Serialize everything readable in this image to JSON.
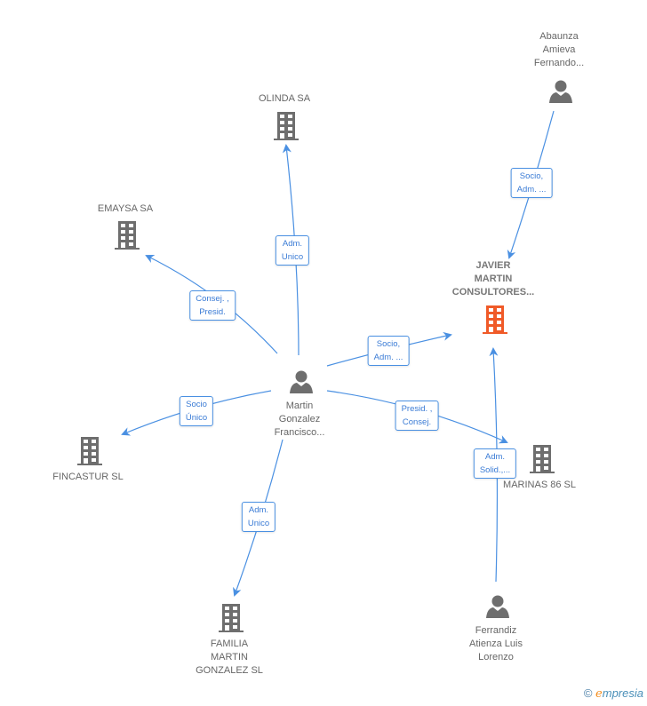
{
  "colors": {
    "edge": "#4a90e2",
    "company": "#6e6e6e",
    "focus_company": "#f05a28",
    "person": "#6e6e6e"
  },
  "nodes": {
    "olinda": {
      "label": "OLINDA SA",
      "type": "company"
    },
    "emaysa": {
      "label": "EMAYSA SA",
      "type": "company"
    },
    "fincastur": {
      "label": "FINCASTUR SL",
      "type": "company"
    },
    "familia": {
      "label": [
        "FAMILIA",
        "MARTIN",
        "GONZALEZ SL"
      ],
      "type": "company"
    },
    "martin": {
      "label": [
        "Martin",
        "Gonzalez",
        "Francisco..."
      ],
      "type": "person"
    },
    "javier": {
      "label": [
        "JAVIER",
        "MARTIN",
        "CONSULTORES..."
      ],
      "type": "company-focus"
    },
    "marinas": {
      "label": "MARINAS 86 SL",
      "type": "company"
    },
    "abaunza": {
      "label": [
        "Abaunza",
        "Amieva",
        "Fernando..."
      ],
      "type": "person"
    },
    "ferrandiz": {
      "label": [
        "Ferrandiz",
        "Atienza Luis",
        "Lorenzo"
      ],
      "type": "person"
    }
  },
  "edges": {
    "martin_olinda": [
      "Adm.",
      "Unico"
    ],
    "martin_emaysa": [
      "Consej. ,",
      "Presid."
    ],
    "martin_fincastur": [
      "Socio",
      "Único"
    ],
    "martin_familia": [
      "Adm.",
      "Unico"
    ],
    "martin_javier": [
      "Socio,",
      "Adm. ..."
    ],
    "martin_marinas": [
      "Presid. ,",
      "Consej."
    ],
    "abaunza_javier": [
      "Socio,",
      "Adm. ..."
    ],
    "ferrandiz_javier": [
      "Adm.",
      "Solid.,..."
    ]
  },
  "brand": {
    "symbol": "©",
    "e": "e",
    "rest": "mpresia"
  }
}
